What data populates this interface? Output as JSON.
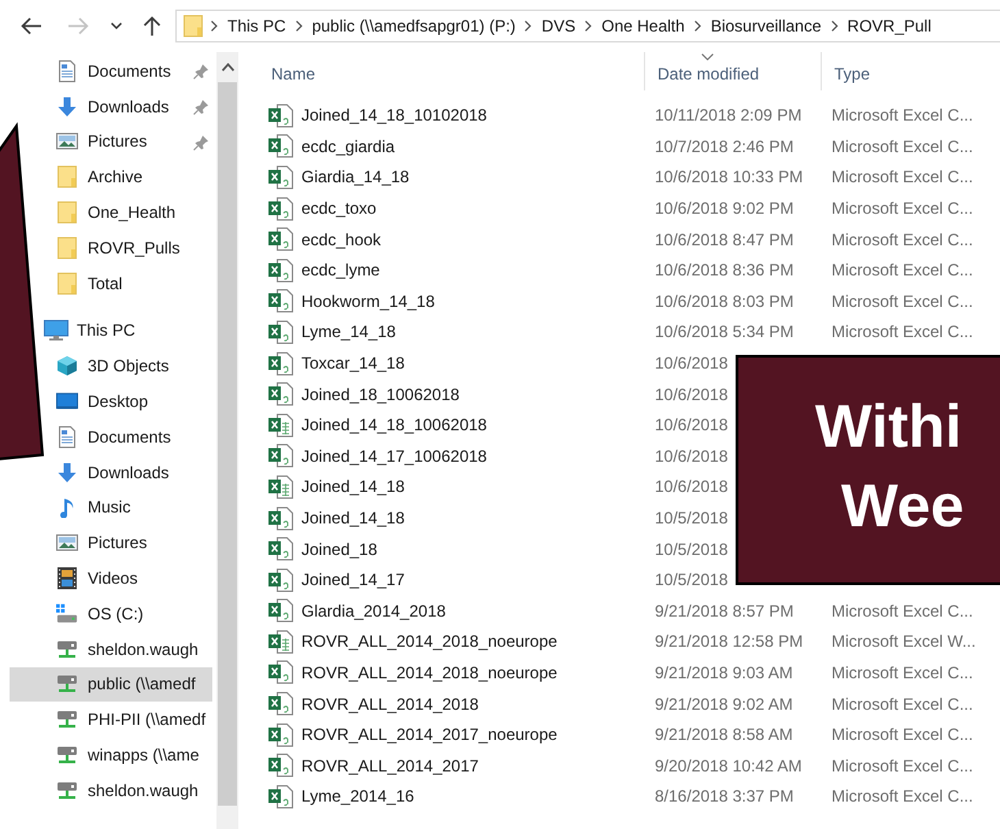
{
  "address_bar": {
    "nav_buttons": [
      {
        "kind": "back",
        "disabled": false
      },
      {
        "kind": "forward",
        "disabled": true
      },
      {
        "kind": "recent",
        "disabled": false
      },
      {
        "kind": "up",
        "disabled": false
      }
    ],
    "breadcrumbs": [
      "This PC",
      "public (\\\\amedfsapgr01) (P:)",
      "DVS",
      "One Health",
      "Biosurveillance",
      "ROVR_Pull"
    ]
  },
  "nav": {
    "quick_access": [
      {
        "label": "Documents",
        "kind": "documents",
        "pinned": true,
        "selected": false
      },
      {
        "label": "Downloads",
        "kind": "downloads",
        "pinned": true,
        "selected": false
      },
      {
        "label": "Pictures",
        "kind": "pictures",
        "pinned": true,
        "selected": false
      },
      {
        "label": "Archive",
        "kind": "folder",
        "pinned": false,
        "selected": false
      },
      {
        "label": "One_Health",
        "kind": "folder",
        "pinned": false,
        "selected": false
      },
      {
        "label": "ROVR_Pulls",
        "kind": "folder",
        "pinned": false,
        "selected": false
      },
      {
        "label": "Total",
        "kind": "folder",
        "pinned": false,
        "selected": false
      }
    ],
    "this_pc": {
      "label": "This PC",
      "selected": false,
      "children": [
        {
          "label": "3D Objects",
          "kind": "objects3d",
          "selected": false
        },
        {
          "label": "Desktop",
          "kind": "desktop",
          "selected": false
        },
        {
          "label": "Documents",
          "kind": "documents",
          "selected": false
        },
        {
          "label": "Downloads",
          "kind": "downloads",
          "selected": false
        },
        {
          "label": "Music",
          "kind": "music",
          "selected": false
        },
        {
          "label": "Pictures",
          "kind": "pictures",
          "selected": false
        },
        {
          "label": "Videos",
          "kind": "videos",
          "selected": false
        },
        {
          "label": "OS (C:)",
          "kind": "drive",
          "selected": false
        },
        {
          "label": "sheldon.waugh",
          "kind": "netdrive",
          "selected": false
        },
        {
          "label": "public (\\\\amedf",
          "kind": "netdrive",
          "selected": true
        },
        {
          "label": "PHI-PII (\\\\amedf",
          "kind": "netdrive",
          "selected": false
        },
        {
          "label": "winapps (\\\\ame",
          "kind": "netdrive",
          "selected": false
        },
        {
          "label": "sheldon.waugh",
          "kind": "netdrive",
          "selected": false
        }
      ]
    }
  },
  "columns": [
    {
      "label": "Name",
      "sorted": false
    },
    {
      "label": "Date modified",
      "sorted": true
    },
    {
      "label": "Type",
      "sorted": false
    }
  ],
  "files": [
    {
      "name": "Joined_14_18_10102018",
      "kind": "csv",
      "date": "10/11/2018 2:09 PM",
      "type": "Microsoft Excel C..."
    },
    {
      "name": "ecdc_giardia",
      "kind": "csv",
      "date": "10/7/2018 2:46 PM",
      "type": "Microsoft Excel C..."
    },
    {
      "name": "Giardia_14_18",
      "kind": "csv",
      "date": "10/6/2018 10:33 PM",
      "type": "Microsoft Excel C..."
    },
    {
      "name": "ecdc_toxo",
      "kind": "csv",
      "date": "10/6/2018 9:02 PM",
      "type": "Microsoft Excel C..."
    },
    {
      "name": "ecdc_hook",
      "kind": "csv",
      "date": "10/6/2018 8:47 PM",
      "type": "Microsoft Excel C..."
    },
    {
      "name": "ecdc_lyme",
      "kind": "csv",
      "date": "10/6/2018 8:36 PM",
      "type": "Microsoft Excel C..."
    },
    {
      "name": "Hookworm_14_18",
      "kind": "csv",
      "date": "10/6/2018 8:03 PM",
      "type": "Microsoft Excel C..."
    },
    {
      "name": "Lyme_14_18",
      "kind": "csv",
      "date": "10/6/2018 5:34 PM",
      "type": "Microsoft Excel C..."
    },
    {
      "name": "Toxcar_14_18",
      "kind": "csv",
      "date": "10/6/2018"
    },
    {
      "name": "Joined_18_10062018",
      "kind": "csv",
      "date": "10/6/2018"
    },
    {
      "name": "Joined_14_18_10062018",
      "kind": "xlsx",
      "date": "10/6/2018"
    },
    {
      "name": "Joined_14_17_10062018",
      "kind": "csv",
      "date": "10/6/2018"
    },
    {
      "name": "Joined_14_18",
      "kind": "xlsx",
      "date": "10/6/2018"
    },
    {
      "name": "Joined_14_18",
      "kind": "csv",
      "date": "10/5/2018"
    },
    {
      "name": "Joined_18",
      "kind": "csv",
      "date": "10/5/2018"
    },
    {
      "name": "Joined_14_17",
      "kind": "csv",
      "date": "10/5/2018"
    },
    {
      "name": "Glardia_2014_2018",
      "kind": "csv",
      "date": "9/21/2018 8:57 PM",
      "type": "Microsoft Excel C..."
    },
    {
      "name": "ROVR_ALL_2014_2018_noeurope",
      "kind": "xlsx",
      "date": "9/21/2018 12:58 PM",
      "type": "Microsoft Excel W..."
    },
    {
      "name": "ROVR_ALL_2014_2018_noeurope",
      "kind": "csv",
      "date": "9/21/2018 9:03 AM",
      "type": "Microsoft Excel C..."
    },
    {
      "name": "ROVR_ALL_2014_2018",
      "kind": "csv",
      "date": "9/21/2018 9:02 AM",
      "type": "Microsoft Excel C..."
    },
    {
      "name": "ROVR_ALL_2014_2017_noeurope",
      "kind": "csv",
      "date": "9/21/2018 8:58 AM",
      "type": "Microsoft Excel C..."
    },
    {
      "name": "ROVR_ALL_2014_2017",
      "kind": "csv",
      "date": "9/20/2018 10:42 AM",
      "type": "Microsoft Excel C..."
    },
    {
      "name": "Lyme_2014_16",
      "kind": "csv",
      "date": "8/16/2018 3:37 PM",
      "type": "Microsoft Excel C..."
    }
  ],
  "callout": {
    "lines": [
      "Withi",
      "Wee"
    ]
  }
}
